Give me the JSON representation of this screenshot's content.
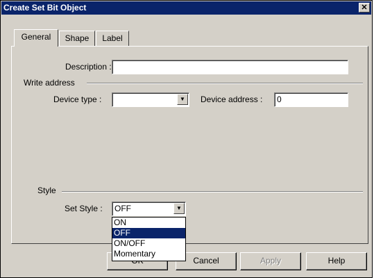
{
  "window": {
    "title": "Create Set Bit Object",
    "close_glyph": "✕"
  },
  "tabs": [
    {
      "label": "General",
      "active": true
    },
    {
      "label": "Shape",
      "active": false
    },
    {
      "label": "Label",
      "active": false
    }
  ],
  "general": {
    "description_label": "Description :",
    "description_value": "",
    "write_address_group": "Write address",
    "device_type_label": "Device type :",
    "device_type_value": "",
    "device_address_label": "Device address :",
    "device_address_value": "0",
    "style_group": "Style",
    "set_style_label": "Set Style :",
    "set_style_value": "OFF",
    "set_style_options": [
      "ON",
      "OFF",
      "ON/OFF",
      "Momentary"
    ],
    "set_style_selected_index": 1
  },
  "buttons": {
    "ok": "OK",
    "cancel": "Cancel",
    "apply": "Apply",
    "help": "Help"
  },
  "icons": {
    "dropdown_arrow": "▼"
  },
  "colors": {
    "titlebar": "#0a246a",
    "face": "#d4d0c8",
    "selection": "#0a246a"
  }
}
